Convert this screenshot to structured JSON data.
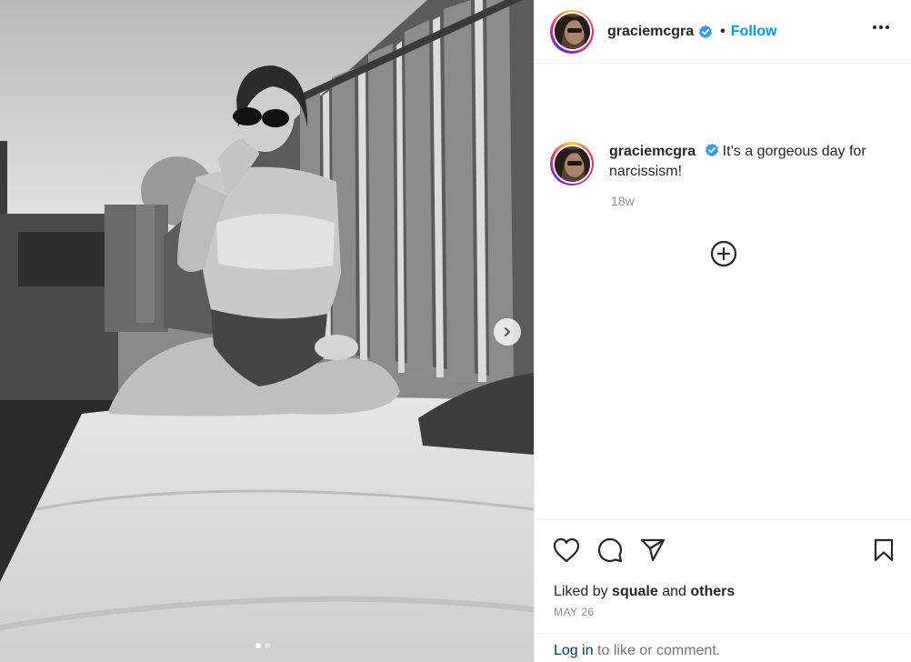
{
  "post": {
    "username": "graciemcgra",
    "follow_label": "Follow",
    "separator": "•",
    "caption_username": "graciemcgra",
    "caption": "It’s a gorgeous day for narcissism!",
    "time_ago": "18w",
    "liked_by_prefix": "Liked by",
    "liked_by_user": "squale",
    "liked_by_and": "and",
    "liked_by_others": "others",
    "date": "MAY 26",
    "login_link": "Log in",
    "login_suffix": "to like or comment."
  },
  "carousel": {
    "current_slide": 1,
    "total_slides": 2
  },
  "icons": {
    "verified": "verified-badge-icon",
    "more": "more-options-icon",
    "add": "add-comment-icon",
    "like": "heart-icon",
    "comment": "comment-icon",
    "share": "share-icon",
    "save": "bookmark-icon",
    "next": "chevron-right-icon"
  },
  "colors": {
    "accent": "#0095f6",
    "verified": "#3897f0",
    "link": "#00376b",
    "muted": "#8e8e8e"
  }
}
